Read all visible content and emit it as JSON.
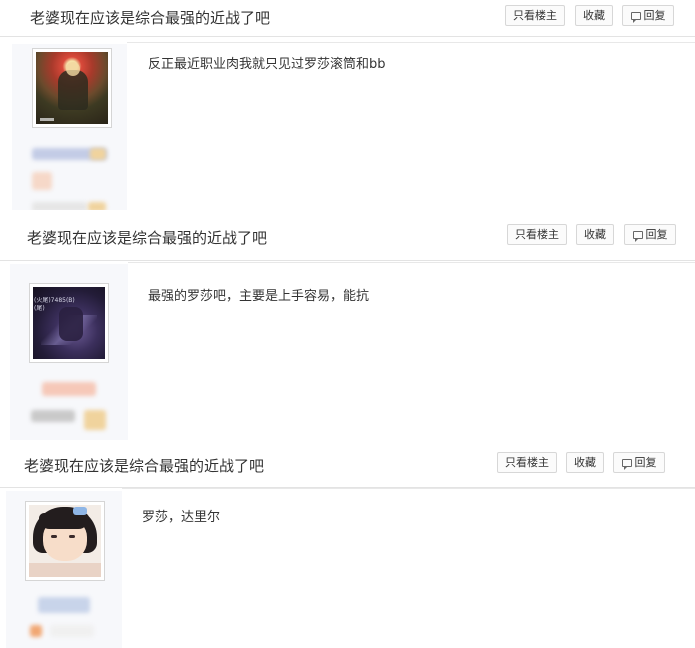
{
  "thread": {
    "title": "老婆现在应该是综合最强的近战了吧"
  },
  "actions": {
    "only_op": "只看楼主",
    "favorite": "收藏",
    "reply": "回复"
  },
  "icons": {
    "reply": "comment-icon"
  },
  "posts": [
    {
      "content": "反正最近职业肉我就只见过罗莎滚筒和bb",
      "avatar_caption": ""
    },
    {
      "content": "最强的罗莎吧，主要是上手容易，能抗",
      "avatar_caption": "(火尾)7485(B)\n(尾)"
    },
    {
      "content": "罗莎，达里尔",
      "avatar_caption": ""
    }
  ],
  "colors": {
    "border": "#d7d7d7",
    "sidebar": "#f7f8fb",
    "text": "#333333"
  }
}
